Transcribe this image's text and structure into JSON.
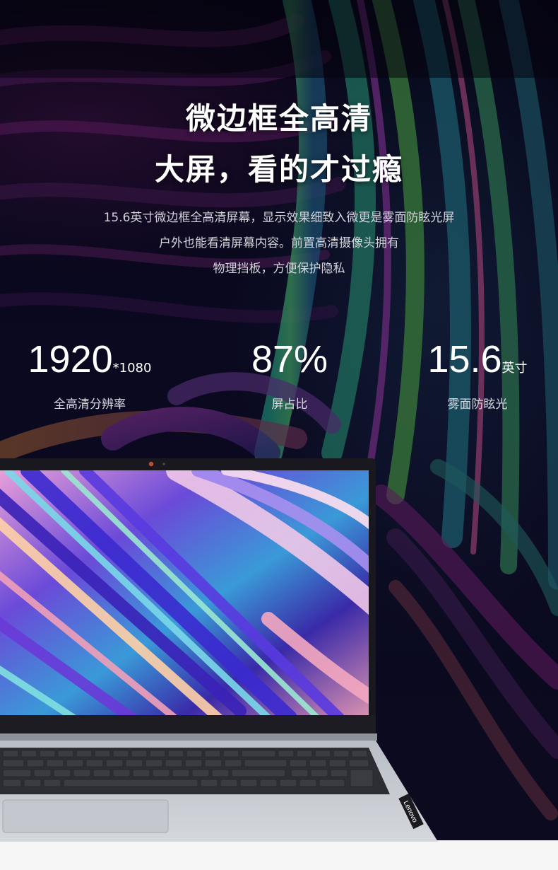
{
  "headline": {
    "line1": "微边框全高清",
    "line2": "大屏，看的才过瘾"
  },
  "description": {
    "line1": "15.6英寸微边框全高清屏幕，显示效果细致入微更是雾面防眩光屏",
    "line2": "户外也能看清屏幕内容。前置高清摄像头拥有",
    "line3": "物理挡板，方便保护隐私"
  },
  "stats": [
    {
      "value": "1920",
      "suffix": "*1080",
      "label": "全高清分辨率"
    },
    {
      "value": "87%",
      "suffix": "",
      "label": "屏占比"
    },
    {
      "value": "15.6",
      "suffix": "英寸",
      "label": "雾面防眩光"
    }
  ],
  "brand": {
    "logo_text": "Lenovo"
  },
  "colors": {
    "background": "#07061a",
    "text_primary": "#ffffff",
    "text_secondary": "#d3d3dc",
    "laptop_body": "#c8ccd2",
    "screen_bezel": "#16161c"
  }
}
